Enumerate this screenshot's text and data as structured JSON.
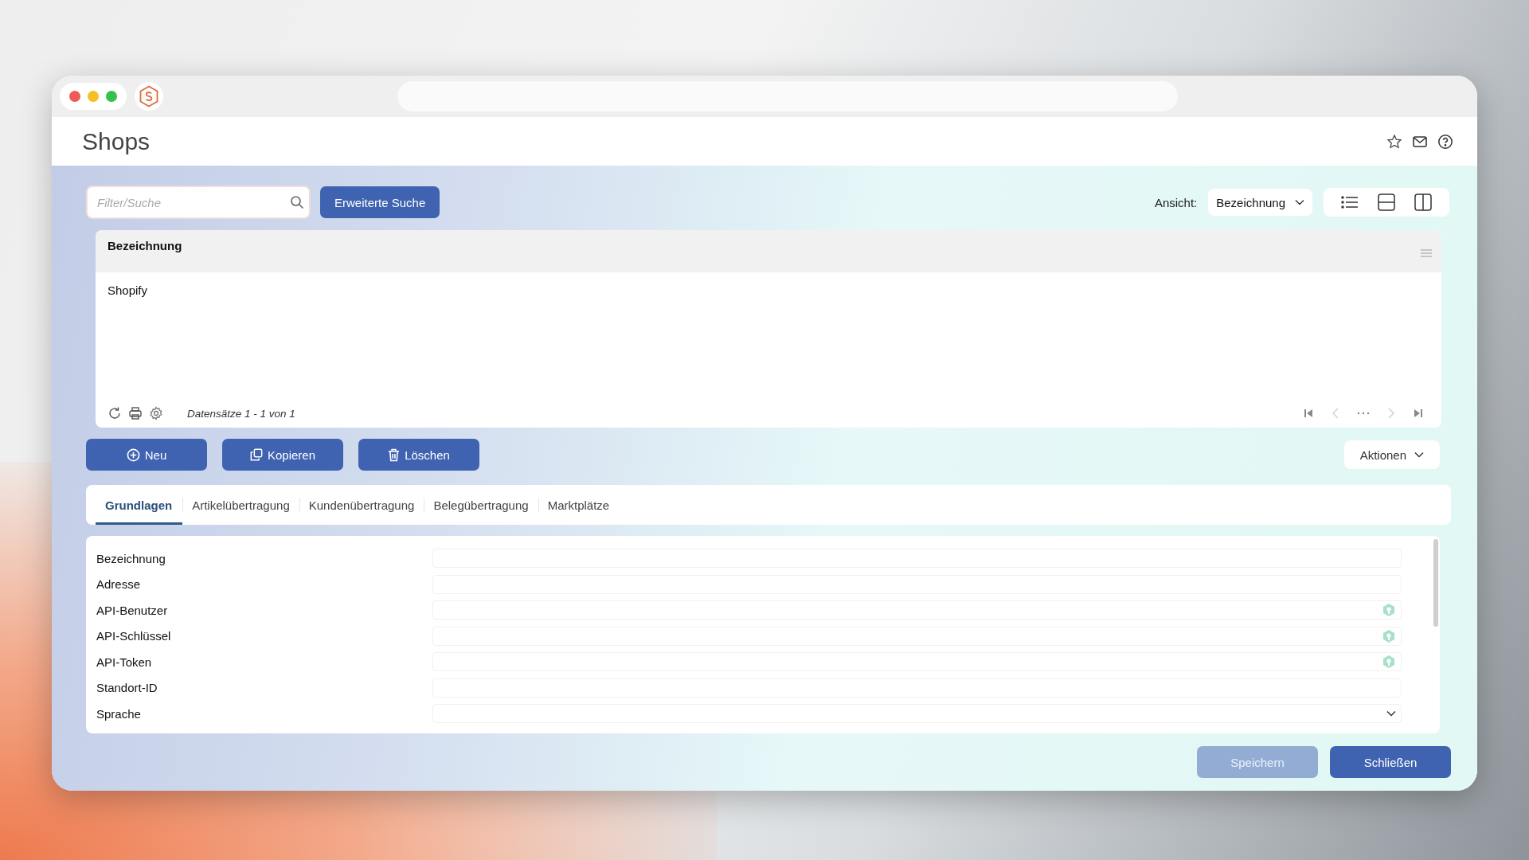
{
  "window": {
    "title": "Shops"
  },
  "search": {
    "placeholder": "Filter/Suche",
    "advanced_button": "Erweiterte Suche"
  },
  "view": {
    "label": "Ansicht:",
    "value": "Bezeichnung"
  },
  "table": {
    "columns": [
      "Bezeichnung"
    ],
    "rows": [
      {
        "cells": [
          "Shopify"
        ],
        "selected": false
      }
    ],
    "footer": "Datensätze 1 - 1 von 1"
  },
  "actions": [
    {
      "kind": "new",
      "label": "Neu"
    },
    {
      "kind": "copy",
      "label": "Kopieren"
    },
    {
      "kind": "delete",
      "label": "Löschen"
    }
  ],
  "actions_menu": "Aktionen",
  "tabs": [
    {
      "label": "Grundlagen",
      "selected": true
    },
    {
      "label": "Artikelübertragung",
      "selected": false
    },
    {
      "label": "Kundenübertragung",
      "selected": false
    },
    {
      "label": "Belegübertragung",
      "selected": false
    },
    {
      "label": "Marktplätze",
      "selected": false
    }
  ],
  "form": [
    {
      "label": "Bezeichnung",
      "kind": "text"
    },
    {
      "label": "Adresse",
      "kind": "text"
    },
    {
      "label": "API-Benutzer",
      "kind": "text",
      "secret": true
    },
    {
      "label": "API-Schlüssel",
      "kind": "text",
      "secret": true
    },
    {
      "label": "API-Token",
      "kind": "text",
      "secret": true
    },
    {
      "label": "Standort-ID",
      "kind": "text"
    },
    {
      "label": "Sprache",
      "kind": "select"
    }
  ],
  "footer_buttons": [
    {
      "label": "Speichern",
      "disabled": true
    },
    {
      "label": "Schließen",
      "disabled": false
    }
  ]
}
